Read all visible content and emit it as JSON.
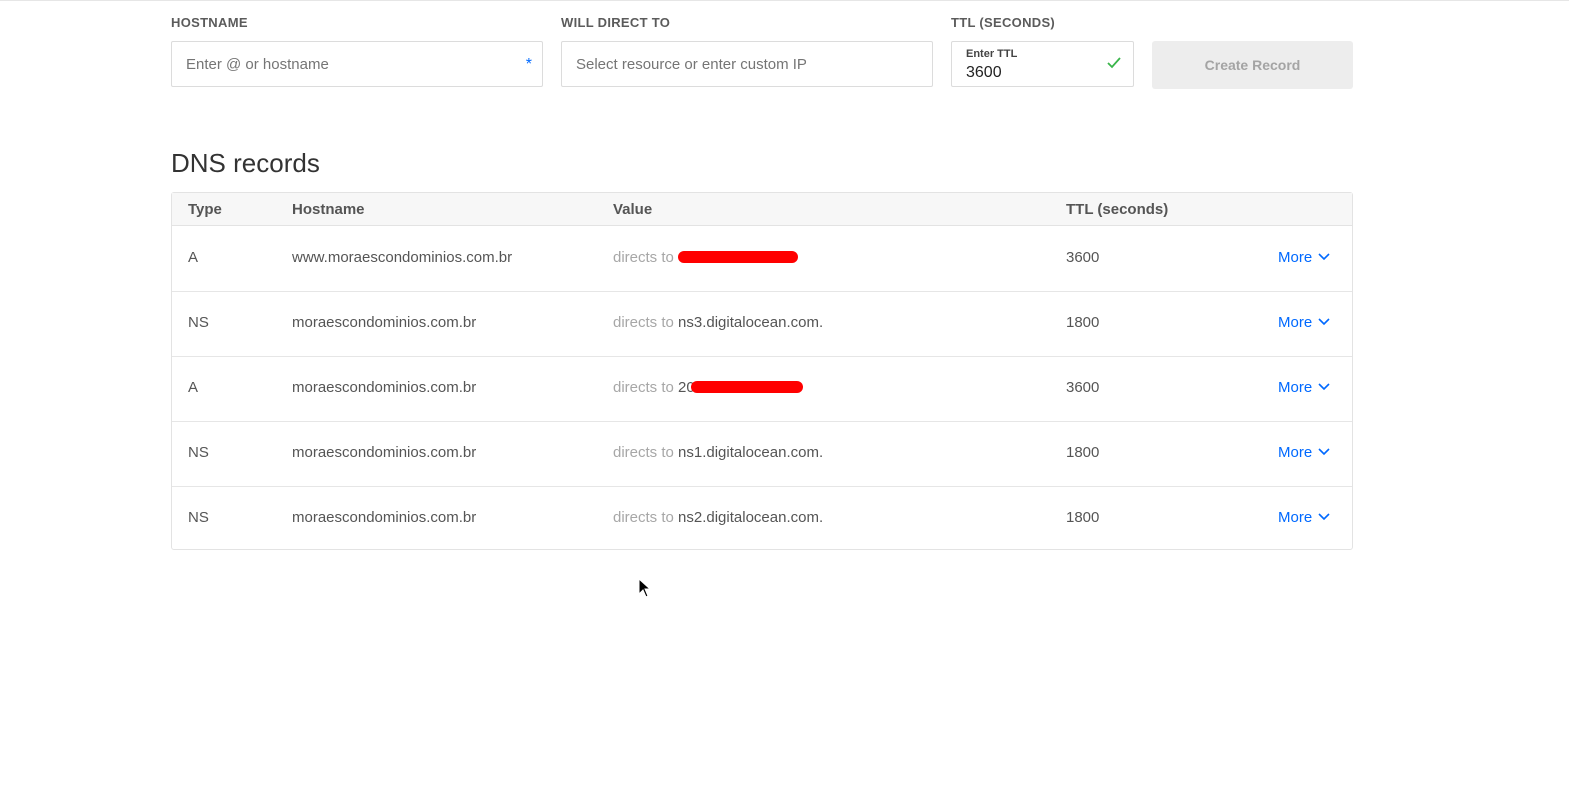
{
  "form": {
    "hostname_label": "HOSTNAME",
    "hostname_placeholder": "Enter @ or hostname",
    "required_mark": "*",
    "direct_label": "WILL DIRECT TO",
    "direct_placeholder": "Select resource or enter custom IP",
    "ttl_label": "TTL (SECONDS)",
    "ttl_inner_label": "Enter TTL",
    "ttl_value": "3600",
    "create_button": "Create Record"
  },
  "section_title": "DNS records",
  "table": {
    "headers": {
      "type": "Type",
      "hostname": "Hostname",
      "value": "Value",
      "ttl": "TTL (seconds)"
    },
    "directs_label": "directs to",
    "more_label": "More",
    "rows": [
      {
        "type": "A",
        "hostname": "www.moraescondominios.com.br",
        "value": "",
        "ttl": "3600",
        "redacted": true
      },
      {
        "type": "NS",
        "hostname": "moraescondominios.com.br",
        "value": "ns3.digitalocean.com.",
        "ttl": "1800",
        "redacted": false
      },
      {
        "type": "A",
        "hostname": "moraescondominios.com.br",
        "value": "20",
        "ttl": "3600",
        "redacted": true
      },
      {
        "type": "NS",
        "hostname": "moraescondominios.com.br",
        "value": "ns1.digitalocean.com.",
        "ttl": "1800",
        "redacted": false
      },
      {
        "type": "NS",
        "hostname": "moraescondominios.com.br",
        "value": "ns2.digitalocean.com.",
        "ttl": "1800",
        "redacted": false
      }
    ]
  },
  "colors": {
    "accent": "#0069ff",
    "check": "#39b54a",
    "redaction": "#ff0000"
  }
}
